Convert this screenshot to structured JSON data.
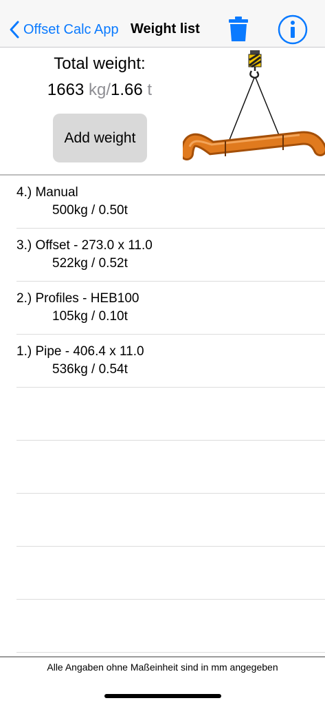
{
  "nav": {
    "back_label": "Offset Calc App",
    "title": "Weight list",
    "accent_color": "#0a7aff"
  },
  "summary": {
    "total_label": "Total weight:",
    "total_kg": "1663",
    "unit_kg": "kg",
    "slash": "/",
    "total_t": "1.66",
    "unit_t": " t",
    "add_button": "Add weight"
  },
  "list": {
    "items": [
      {
        "title": "4.) Manual",
        "weight": "500kg / 0.50t"
      },
      {
        "title": "3.) Offset - 273.0 x 11.0",
        "weight": "522kg / 0.52t"
      },
      {
        "title": "2.) Profiles - HEB100",
        "weight": "105kg / 0.10t"
      },
      {
        "title": "1.) Pipe - 406.4 x 11.0",
        "weight": "536kg / 0.54t"
      }
    ]
  },
  "footer": {
    "note": "Alle Angaben ohne Maßeinheit sind in mm angegeben"
  }
}
